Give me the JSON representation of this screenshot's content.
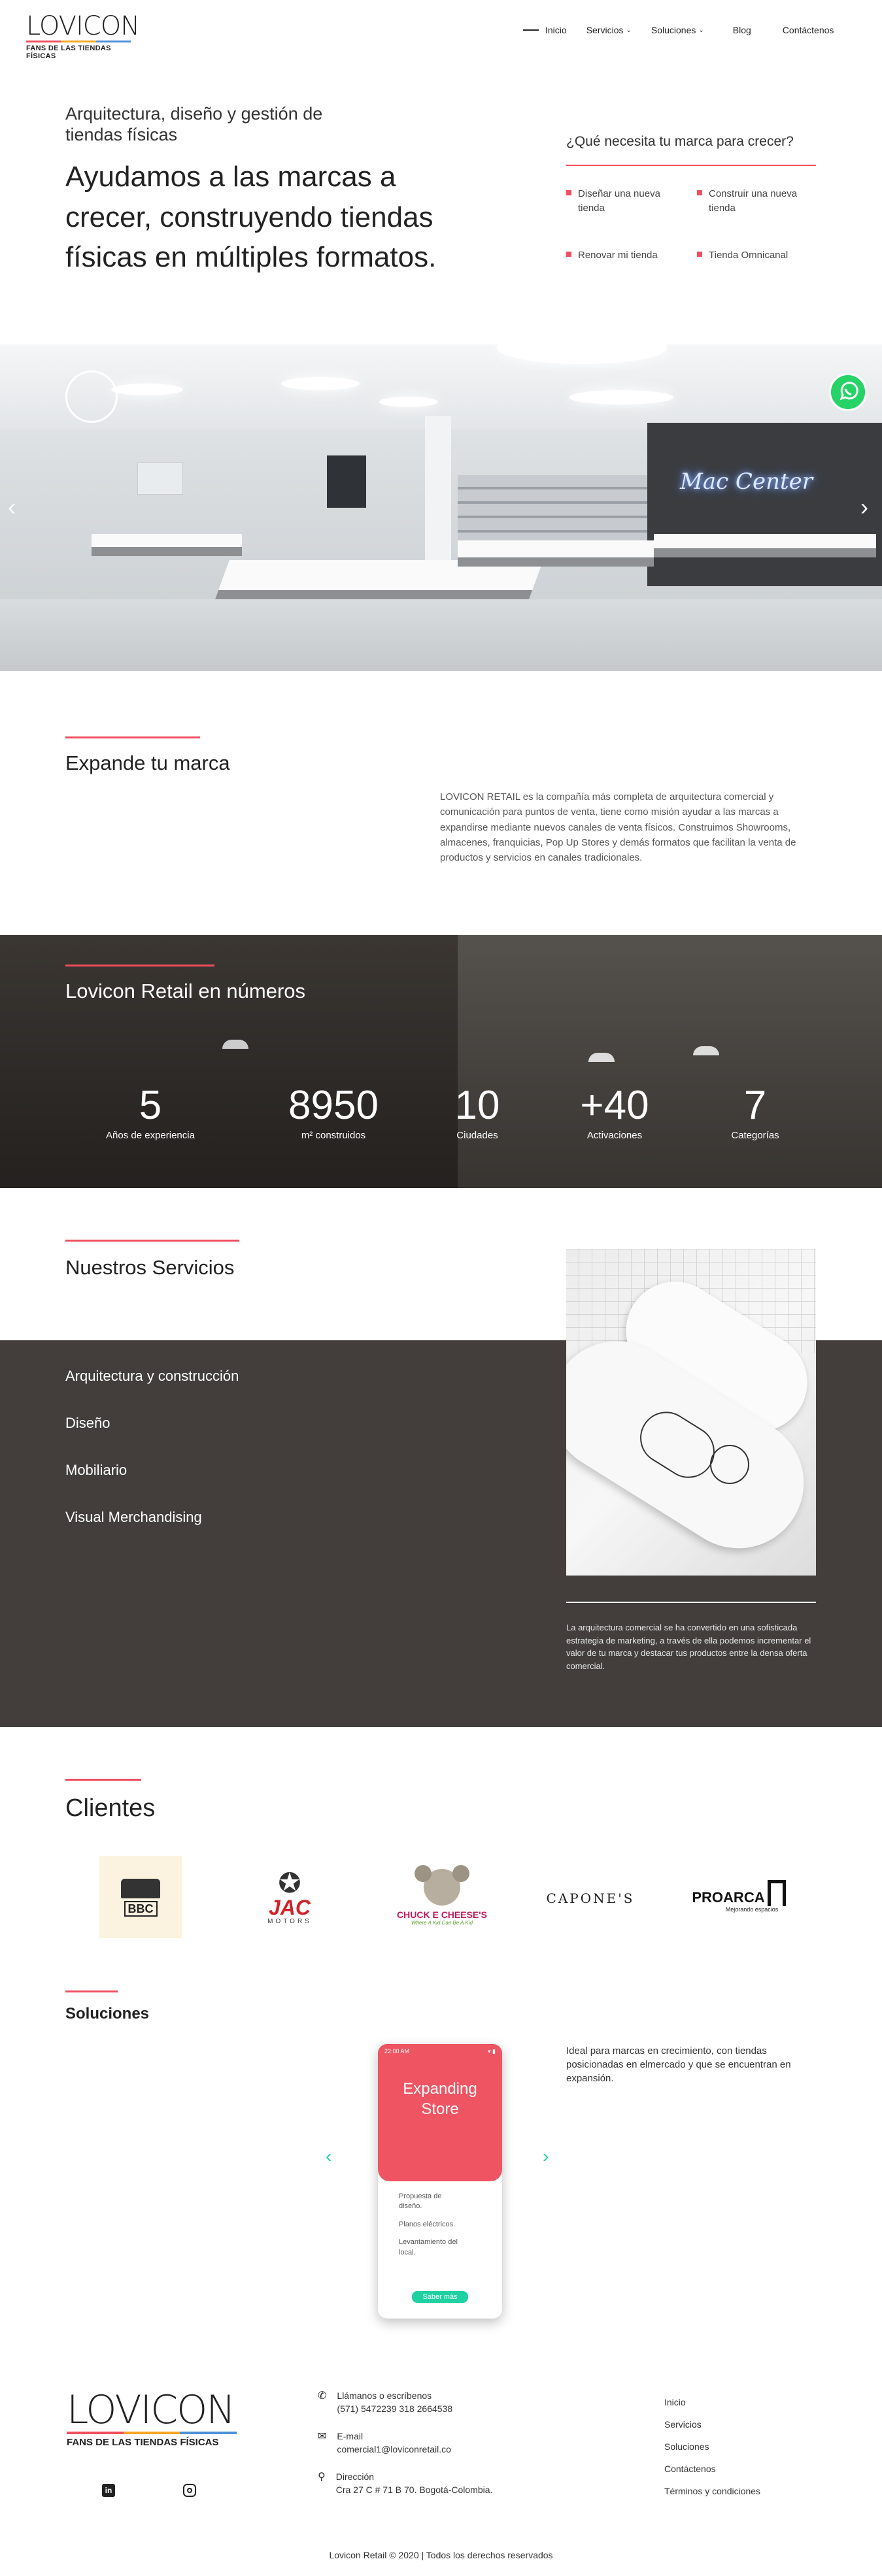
{
  "header": {
    "logo_text": "LOVICON",
    "logo_tagline": "FANS DE LAS TIENDAS FÍSICAS",
    "nav": [
      {
        "label": "Inicio"
      },
      {
        "label": "Servicios"
      },
      {
        "label": "Soluciones"
      },
      {
        "label": "Blog"
      },
      {
        "label": "Contáctenos"
      }
    ]
  },
  "hero": {
    "subtitle": "Arquitectura, diseño y gestión de tiendas físicas",
    "title": "Ayudamos a las marcas a crecer, construyendo tiendas físicas en múltiples formatos.",
    "need_title": "¿Qué necesita tu marca para crecer?",
    "options": [
      "Diseñar una nueva tienda",
      "Construir una nueva tienda",
      "Renovar mi tienda",
      "Tienda Omnicanal"
    ]
  },
  "slider": {
    "neon_sign": "Mac Center"
  },
  "expande": {
    "title": "Expande tu marca",
    "text": "LOVICON RETAIL es la compañía más completa de arquitectura comercial y comunicación para puntos de venta, tiene como misión ayudar a las marcas a expandirse mediante nuevos canales de venta físicos. Construimos Showrooms, almacenes, franquicias, Pop Up Stores y demás formatos que facilitan la venta de productos y servicios en canales tradicionales."
  },
  "numbers": {
    "title": "Lovicon Retail en números",
    "stats": [
      {
        "value": "5",
        "label": "Años de experiencia"
      },
      {
        "value": "8950",
        "label": "m² construidos"
      },
      {
        "value": "10",
        "label": "Ciudades"
      },
      {
        "value": "+40",
        "label": "Activaciones"
      },
      {
        "value": "7",
        "label": "Categorías"
      }
    ]
  },
  "services": {
    "title": "Nuestros Servicios",
    "items": [
      "Arquitectura y construcción",
      "Diseño",
      "Mobiliario",
      "Visual Merchandising"
    ],
    "description": "La arquitectura comercial se ha convertido en una sofisticada estrategia de marketing, a través de ella podemos incrementar el valor de tu marca y destacar tus productos entre la densa oferta comercial."
  },
  "clients": {
    "title": "Clientes",
    "logos": [
      {
        "name": "BBC",
        "text": "BBC"
      },
      {
        "name": "JAC",
        "text": "JAC",
        "sub": "MOTORS"
      },
      {
        "name": "Chuck E. Cheese's",
        "text": "CHUCK E CHEESE'S",
        "sub": "Where A Kid Can Be A Kid"
      },
      {
        "name": "Capone's",
        "text": "CAPONE'S"
      },
      {
        "name": "Proarca",
        "text": "PROARCA",
        "sub": "Mejorando espacios"
      }
    ]
  },
  "solutions": {
    "title": "Soluciones",
    "phone_time": "22:00 AM",
    "card_title": "Expanding Store",
    "card_items": [
      "Propuesta de diseño.",
      "Planos eléctricos.",
      "Levantamiento del local."
    ],
    "card_button": "Saber más",
    "description": "Ideal para marcas en crecimiento, con tiendas posicionadas en elmercado y que se encuentran en expansión."
  },
  "footer": {
    "logo_text": "LOVICON",
    "logo_tagline": "FANS DE LAS TIENDAS FÍSICAS",
    "phone_label": "Llámanos o escríbenos",
    "phone_value": "(571) 5472239 318 2664538",
    "email_label": "E-mail",
    "email_value": "comercial1@loviconretail.co",
    "address_label": "Dirección",
    "address_value": "Cra 27 C # 71 B 70. Bogotá-Colombia.",
    "links": [
      "Inicio",
      "Servicios",
      "Soluciones",
      "Contáctenos",
      "Términos y condiciones"
    ],
    "copyright": "Lovicon Retail © 2020 | Todos los derechos reservados"
  },
  "colors": {
    "accent": "#f04e5e",
    "dark": "#433e3c",
    "teal": "#1fd1a1",
    "whatsapp": "#25d366"
  }
}
